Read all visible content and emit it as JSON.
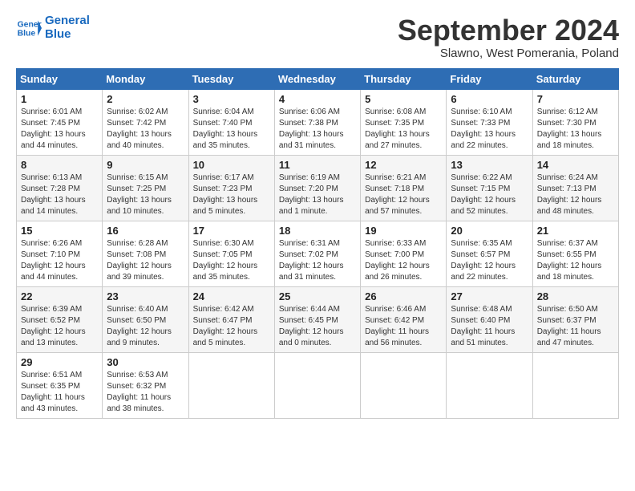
{
  "header": {
    "logo_line1": "General",
    "logo_line2": "Blue",
    "main_title": "September 2024",
    "sub_title": "Slawno, West Pomerania, Poland"
  },
  "days_of_week": [
    "Sunday",
    "Monday",
    "Tuesday",
    "Wednesday",
    "Thursday",
    "Friday",
    "Saturday"
  ],
  "weeks": [
    [
      {
        "day": "1",
        "info": "Sunrise: 6:01 AM\nSunset: 7:45 PM\nDaylight: 13 hours\nand 44 minutes."
      },
      {
        "day": "2",
        "info": "Sunrise: 6:02 AM\nSunset: 7:42 PM\nDaylight: 13 hours\nand 40 minutes."
      },
      {
        "day": "3",
        "info": "Sunrise: 6:04 AM\nSunset: 7:40 PM\nDaylight: 13 hours\nand 35 minutes."
      },
      {
        "day": "4",
        "info": "Sunrise: 6:06 AM\nSunset: 7:38 PM\nDaylight: 13 hours\nand 31 minutes."
      },
      {
        "day": "5",
        "info": "Sunrise: 6:08 AM\nSunset: 7:35 PM\nDaylight: 13 hours\nand 27 minutes."
      },
      {
        "day": "6",
        "info": "Sunrise: 6:10 AM\nSunset: 7:33 PM\nDaylight: 13 hours\nand 22 minutes."
      },
      {
        "day": "7",
        "info": "Sunrise: 6:12 AM\nSunset: 7:30 PM\nDaylight: 13 hours\nand 18 minutes."
      }
    ],
    [
      {
        "day": "8",
        "info": "Sunrise: 6:13 AM\nSunset: 7:28 PM\nDaylight: 13 hours\nand 14 minutes."
      },
      {
        "day": "9",
        "info": "Sunrise: 6:15 AM\nSunset: 7:25 PM\nDaylight: 13 hours\nand 10 minutes."
      },
      {
        "day": "10",
        "info": "Sunrise: 6:17 AM\nSunset: 7:23 PM\nDaylight: 13 hours\nand 5 minutes."
      },
      {
        "day": "11",
        "info": "Sunrise: 6:19 AM\nSunset: 7:20 PM\nDaylight: 13 hours\nand 1 minute."
      },
      {
        "day": "12",
        "info": "Sunrise: 6:21 AM\nSunset: 7:18 PM\nDaylight: 12 hours\nand 57 minutes."
      },
      {
        "day": "13",
        "info": "Sunrise: 6:22 AM\nSunset: 7:15 PM\nDaylight: 12 hours\nand 52 minutes."
      },
      {
        "day": "14",
        "info": "Sunrise: 6:24 AM\nSunset: 7:13 PM\nDaylight: 12 hours\nand 48 minutes."
      }
    ],
    [
      {
        "day": "15",
        "info": "Sunrise: 6:26 AM\nSunset: 7:10 PM\nDaylight: 12 hours\nand 44 minutes."
      },
      {
        "day": "16",
        "info": "Sunrise: 6:28 AM\nSunset: 7:08 PM\nDaylight: 12 hours\nand 39 minutes."
      },
      {
        "day": "17",
        "info": "Sunrise: 6:30 AM\nSunset: 7:05 PM\nDaylight: 12 hours\nand 35 minutes."
      },
      {
        "day": "18",
        "info": "Sunrise: 6:31 AM\nSunset: 7:02 PM\nDaylight: 12 hours\nand 31 minutes."
      },
      {
        "day": "19",
        "info": "Sunrise: 6:33 AM\nSunset: 7:00 PM\nDaylight: 12 hours\nand 26 minutes."
      },
      {
        "day": "20",
        "info": "Sunrise: 6:35 AM\nSunset: 6:57 PM\nDaylight: 12 hours\nand 22 minutes."
      },
      {
        "day": "21",
        "info": "Sunrise: 6:37 AM\nSunset: 6:55 PM\nDaylight: 12 hours\nand 18 minutes."
      }
    ],
    [
      {
        "day": "22",
        "info": "Sunrise: 6:39 AM\nSunset: 6:52 PM\nDaylight: 12 hours\nand 13 minutes."
      },
      {
        "day": "23",
        "info": "Sunrise: 6:40 AM\nSunset: 6:50 PM\nDaylight: 12 hours\nand 9 minutes."
      },
      {
        "day": "24",
        "info": "Sunrise: 6:42 AM\nSunset: 6:47 PM\nDaylight: 12 hours\nand 5 minutes."
      },
      {
        "day": "25",
        "info": "Sunrise: 6:44 AM\nSunset: 6:45 PM\nDaylight: 12 hours\nand 0 minutes."
      },
      {
        "day": "26",
        "info": "Sunrise: 6:46 AM\nSunset: 6:42 PM\nDaylight: 11 hours\nand 56 minutes."
      },
      {
        "day": "27",
        "info": "Sunrise: 6:48 AM\nSunset: 6:40 PM\nDaylight: 11 hours\nand 51 minutes."
      },
      {
        "day": "28",
        "info": "Sunrise: 6:50 AM\nSunset: 6:37 PM\nDaylight: 11 hours\nand 47 minutes."
      }
    ],
    [
      {
        "day": "29",
        "info": "Sunrise: 6:51 AM\nSunset: 6:35 PM\nDaylight: 11 hours\nand 43 minutes."
      },
      {
        "day": "30",
        "info": "Sunrise: 6:53 AM\nSunset: 6:32 PM\nDaylight: 11 hours\nand 38 minutes."
      },
      {
        "day": "",
        "info": ""
      },
      {
        "day": "",
        "info": ""
      },
      {
        "day": "",
        "info": ""
      },
      {
        "day": "",
        "info": ""
      },
      {
        "day": "",
        "info": ""
      }
    ]
  ]
}
